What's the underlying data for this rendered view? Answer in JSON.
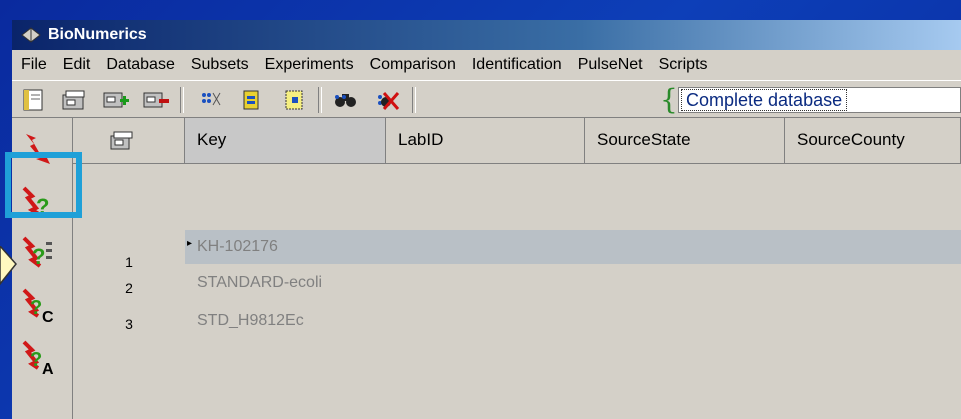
{
  "window": {
    "title": "BioNumerics"
  },
  "menu": [
    "File",
    "Edit",
    "Database",
    "Subsets",
    "Experiments",
    "Comparison",
    "Identification",
    "PulseNet",
    "Scripts"
  ],
  "toolbar": {
    "database_selector": "Complete database"
  },
  "leftbar": {
    "letters": {
      "c": "C",
      "a": "A"
    }
  },
  "columns": [
    "Key",
    "LabID",
    "SourceState",
    "SourceCounty"
  ],
  "rows": [
    {
      "num": "1",
      "key": "KH-102176"
    },
    {
      "num": "2",
      "key": "STANDARD-ecoli"
    },
    {
      "num": "3",
      "key": "STD_H9812Ec"
    }
  ],
  "colors": {
    "highlight": "#1fa0d8",
    "selected_row": "#b9c0c6",
    "background": "#0d3fb8"
  }
}
